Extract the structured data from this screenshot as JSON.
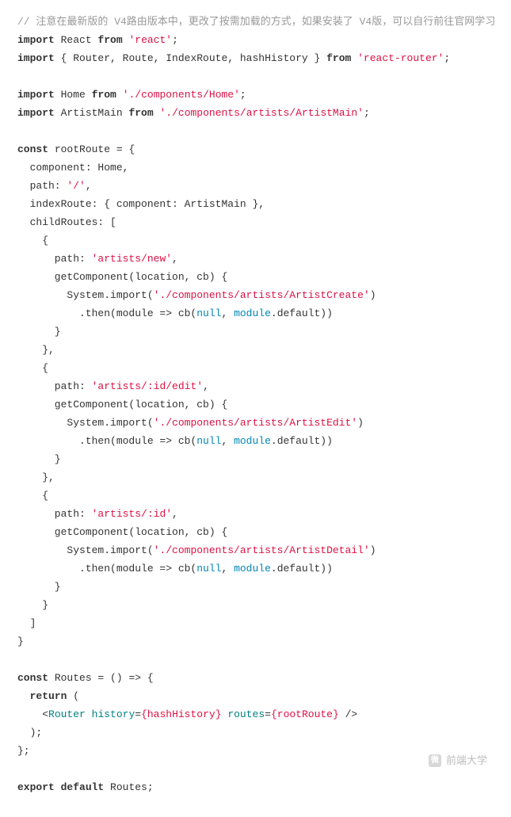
{
  "code": {
    "comment_line": "// 注意在最新版的 V4路由版本中，更改了按需加载的方式，如果安装了 V4版，可以自行前往官网学习",
    "import1": {
      "kw_import": "import",
      "name": "React",
      "kw_from": "from",
      "mod": "'react'",
      "semi": ";"
    },
    "import2": {
      "kw_import": "import",
      "names": "{ Router, Route, IndexRoute, hashHistory }",
      "kw_from": "from",
      "mod": "'react-router'",
      "semi": ";"
    },
    "import3": {
      "kw_import": "import",
      "name": "Home",
      "kw_from": "from",
      "mod": "'./components/Home'",
      "semi": ";"
    },
    "import4": {
      "kw_import": "import",
      "name": "ArtistMain",
      "kw_from": "from",
      "mod": "'./components/artists/ArtistMain'",
      "semi": ";"
    },
    "rootRoute": {
      "decl": {
        "kw_const": "const",
        "name": "rootRoute = {"
      },
      "component": "  component: Home,",
      "path_lead": "  path: ",
      "path_val": "'/'",
      "indexRoute": "  indexRoute: { component: ArtistMain },",
      "childRoutes_open": "  childRoutes: [",
      "child1": {
        "open": "    {",
        "path_lead": "      path: ",
        "path_val": "'artists/new'",
        "getComp": "      getComponent(location, cb) {",
        "sys_lead": "        System.import(",
        "sys_mod": "'./components/artists/ArtistCreate'",
        "sys_tail": ")",
        "then_lead": "          .then(module => cb(",
        "then_null": "null",
        "then_mid": ", ",
        "then_module": "module",
        "then_tail": ".default))",
        "close_fn": "      }",
        "close_obj": "    },"
      },
      "child2": {
        "open": "    {",
        "path_lead": "      path: ",
        "path_val": "'artists/:id/edit'",
        "getComp": "      getComponent(location, cb) {",
        "sys_lead": "        System.import(",
        "sys_mod": "'./components/artists/ArtistEdit'",
        "sys_tail": ")",
        "then_lead": "          .then(module => cb(",
        "then_null": "null",
        "then_mid": ", ",
        "then_module": "module",
        "then_tail": ".default))",
        "close_fn": "      }",
        "close_obj": "    },"
      },
      "child3": {
        "open": "    {",
        "path_lead": "      path: ",
        "path_val": "'artists/:id'",
        "getComp": "      getComponent(location, cb) {",
        "sys_lead": "        System.import(",
        "sys_mod": "'./components/artists/ArtistDetail'",
        "sys_tail": ")",
        "then_lead": "          .then(module => cb(",
        "then_null": "null",
        "then_mid": ", ",
        "then_module": "module",
        "then_tail": ".default))",
        "close_fn": "      }",
        "close_obj": "    }"
      },
      "childRoutes_close": "  ]",
      "decl_close": "}"
    },
    "routes": {
      "decl": {
        "kw_const": "const",
        "rest": "Routes = () => {"
      },
      "return_open": {
        "kw_return": "return",
        "rest": " ("
      },
      "jsx_lead": "    <",
      "jsx_tag": "Router",
      "jsx_sp1": " ",
      "jsx_attr1": "history",
      "jsx_eq1": "=",
      "jsx_val1_open": "{",
      "jsx_val1": "hashHistory",
      "jsx_val1_close": "}",
      "jsx_sp2": " ",
      "jsx_attr2": "routes",
      "jsx_eq2": "=",
      "jsx_val2_open": "{",
      "jsx_val2": "rootRoute",
      "jsx_val2_close": "}",
      "jsx_tail": " />",
      "return_close": "  );",
      "decl_close": "};"
    },
    "export_line": {
      "kw_export": "export",
      "kw_default": "default",
      "rest": "Routes;"
    }
  },
  "watermark": {
    "icon_text": "微",
    "text": "前端大学"
  }
}
